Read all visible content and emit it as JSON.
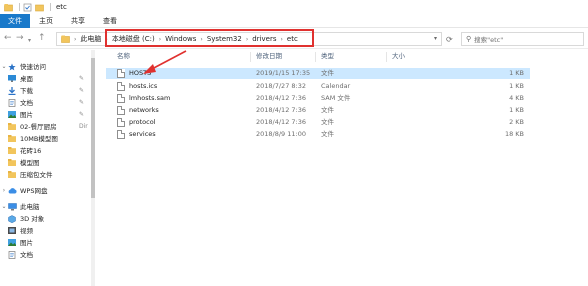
{
  "window": {
    "title": "etc"
  },
  "ribbon": {
    "tabs": [
      "文件",
      "主页",
      "共享",
      "查看"
    ]
  },
  "address": {
    "breadcrumbs": [
      "此电脑",
      "本地磁盘 (C:)",
      "Windows",
      "System32",
      "drivers",
      "etc"
    ]
  },
  "search": {
    "placeholder": "搜索\"etc\""
  },
  "columns": {
    "name": "名称",
    "date": "修改日期",
    "type": "类型",
    "size": "大小"
  },
  "files": [
    {
      "name": "HOSTS",
      "date": "2019/1/15 17:35",
      "type": "文件",
      "size": "1 KB",
      "selected": true
    },
    {
      "name": "hosts.ics",
      "date": "2018/7/27 8:32",
      "type": "Calendar",
      "size": "1 KB",
      "selected": false
    },
    {
      "name": "lmhosts.sam",
      "date": "2018/4/12 7:36",
      "type": "SAM 文件",
      "size": "4 KB",
      "selected": false
    },
    {
      "name": "networks",
      "date": "2018/4/12 7:36",
      "type": "文件",
      "size": "1 KB",
      "selected": false
    },
    {
      "name": "protocol",
      "date": "2018/4/12 7:36",
      "type": "文件",
      "size": "2 KB",
      "selected": false
    },
    {
      "name": "services",
      "date": "2018/8/9 11:00",
      "type": "文件",
      "size": "18 KB",
      "selected": false
    }
  ],
  "sidebar": {
    "quick_access": "快速访问",
    "items": [
      {
        "label": "桌面",
        "icon": "desktop-icon",
        "pinned": true
      },
      {
        "label": "下载",
        "icon": "download-icon",
        "pinned": true
      },
      {
        "label": "文档",
        "icon": "documents-icon",
        "pinned": true
      },
      {
        "label": "图片",
        "icon": "pictures-icon",
        "pinned": true
      },
      {
        "label": "02-餐厅厨房",
        "icon": "folder-icon",
        "pinned": false
      },
      {
        "label": "10MB模型图",
        "icon": "folder-icon",
        "pinned": false
      },
      {
        "label": "花砖16",
        "icon": "folder-icon",
        "pinned": false
      },
      {
        "label": "模型图",
        "icon": "folder-icon",
        "pinned": false
      },
      {
        "label": "压缩包文件",
        "icon": "folder-icon",
        "pinned": false
      }
    ],
    "wps": "WPS网盘",
    "this_pc": "此电脑",
    "pc_items": [
      {
        "label": "3D 对象",
        "icon": "3d-objects-icon"
      },
      {
        "label": "视频",
        "icon": "videos-icon"
      },
      {
        "label": "图片",
        "icon": "pictures-icon"
      },
      {
        "label": "文档",
        "icon": "documents-icon"
      }
    ]
  },
  "colors": {
    "accent": "#1979ca",
    "selection": "#cce8ff",
    "annotation": "#e0312f",
    "folder": "#f2c55c"
  }
}
